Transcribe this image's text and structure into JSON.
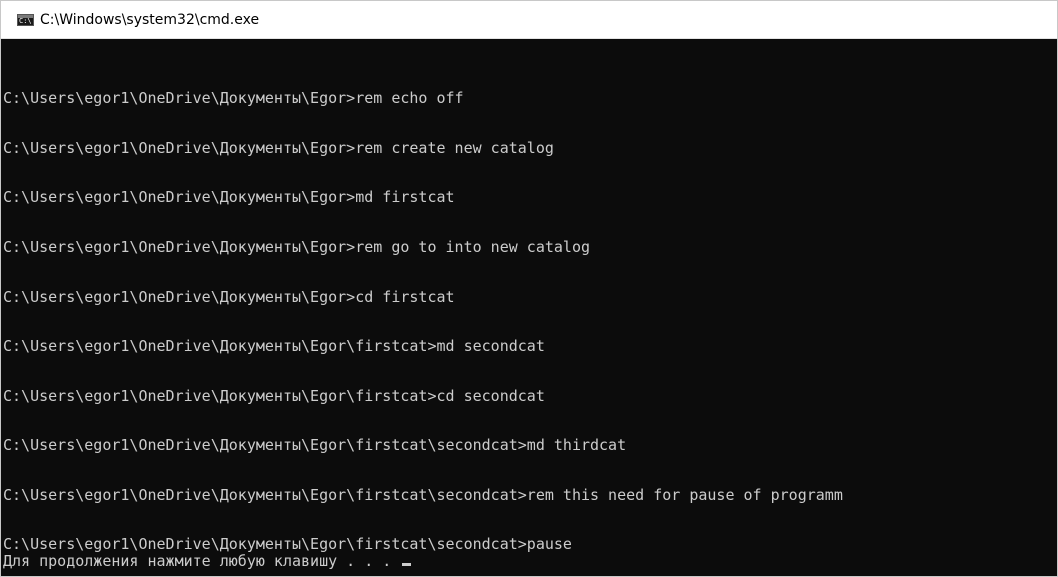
{
  "window": {
    "title": "C:\\Windows\\system32\\cmd.exe"
  },
  "console": {
    "lines": [
      "C:\\Users\\egor1\\OneDrive\\Документы\\Egor>rem echo off",
      "C:\\Users\\egor1\\OneDrive\\Документы\\Egor>rem create new catalog",
      "C:\\Users\\egor1\\OneDrive\\Документы\\Egor>md firstcat",
      "C:\\Users\\egor1\\OneDrive\\Документы\\Egor>rem go to into new catalog",
      "C:\\Users\\egor1\\OneDrive\\Документы\\Egor>cd firstcat",
      "C:\\Users\\egor1\\OneDrive\\Документы\\Egor\\firstcat>md secondcat",
      "C:\\Users\\egor1\\OneDrive\\Документы\\Egor\\firstcat>cd secondcat",
      "C:\\Users\\egor1\\OneDrive\\Документы\\Egor\\firstcat\\secondcat>md thirdcat",
      "C:\\Users\\egor1\\OneDrive\\Документы\\Egor\\firstcat\\secondcat>rem this need for pause of programm",
      "C:\\Users\\egor1\\OneDrive\\Документы\\Egor\\firstcat\\secondcat>pause"
    ],
    "pause_message": "Для продолжения нажмите любую клавишу . . . "
  },
  "icons": {
    "window_icon": "cmd-console-icon"
  },
  "colors": {
    "background": "#0c0c0c",
    "foreground": "#cccccc",
    "titlebar": "#ffffff"
  }
}
